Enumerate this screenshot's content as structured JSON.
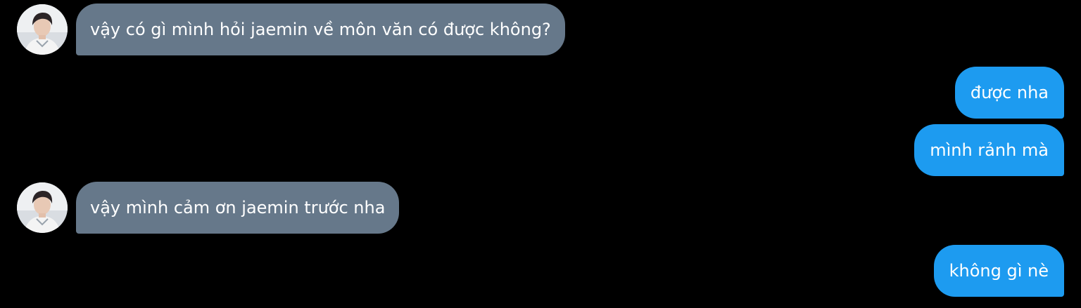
{
  "conversation": {
    "messages": [
      {
        "direction": "incoming",
        "text": "vậy có gì mình hỏi jaemin về môn văn có được không?",
        "avatar_icon": "user-avatar-photo"
      },
      {
        "direction": "outgoing",
        "text": "được nha"
      },
      {
        "direction": "outgoing",
        "text": "mình rảnh mà"
      },
      {
        "direction": "incoming",
        "text": "vậy mình cảm ơn jaemin trước nha",
        "avatar_icon": "user-avatar-photo"
      },
      {
        "direction": "outgoing",
        "text": "không gì nè"
      }
    ]
  },
  "colors": {
    "background": "#000000",
    "incoming_bubble": "#66788a",
    "outgoing_bubble": "#1d9bf0",
    "text": "#ffffff"
  }
}
